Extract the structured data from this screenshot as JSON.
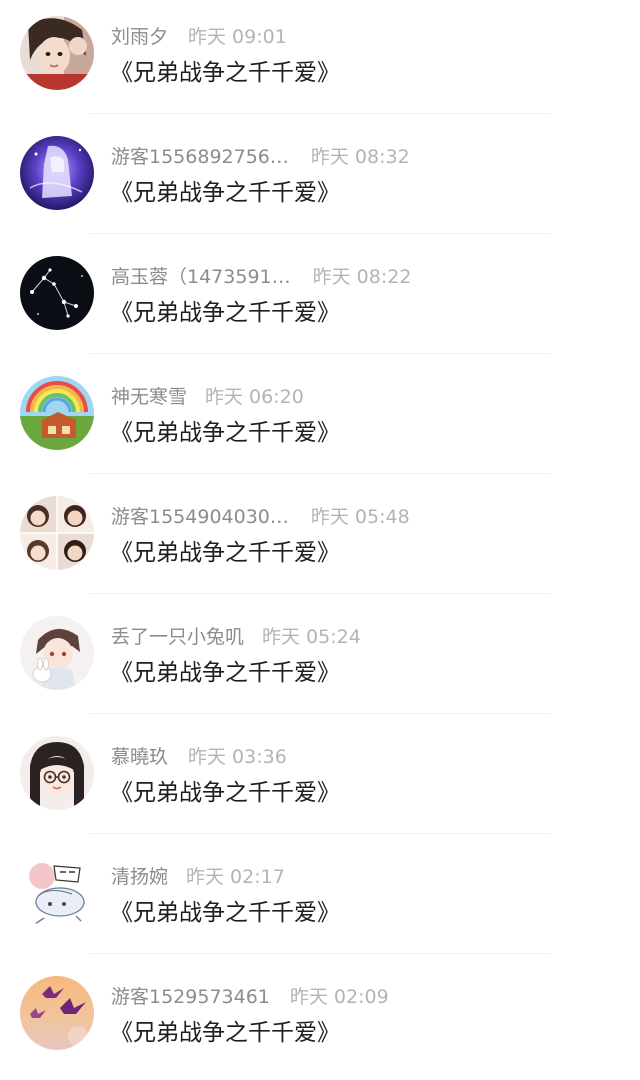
{
  "comments": [
    {
      "name": "刘雨夕",
      "time": "昨天 09:01",
      "message": "《兄弟战争之千千爱》",
      "avatar": "avatar-girl-selfie"
    },
    {
      "name": "游客1556892756…",
      "time": "昨天 08:32",
      "message": "《兄弟战争之千千爱》",
      "avatar": "avatar-anime-purple"
    },
    {
      "name": "高玉蓉（1473591…",
      "time": "昨天 08:22",
      "message": "《兄弟战争之千千爱》",
      "avatar": "avatar-constellation"
    },
    {
      "name": "神无寒雪",
      "time": "昨天 06:20",
      "message": "《兄弟战争之千千爱》",
      "avatar": "avatar-rainbow-house"
    },
    {
      "name": "游客1554904030…",
      "time": "昨天 05:48",
      "message": "《兄弟战争之千千爱》",
      "avatar": "avatar-four-girls"
    },
    {
      "name": "丢了一只小兔叽",
      "time": "昨天 05:24",
      "message": "《兄弟战争之千千爱》",
      "avatar": "avatar-anime-boy"
    },
    {
      "name": "慕曉玖",
      "time": "昨天 03:36",
      "message": "《兄弟战争之千千爱》",
      "avatar": "avatar-girl-glasses"
    },
    {
      "name": "清扬婉",
      "time": "昨天 02:17",
      "message": "《兄弟战争之千千爱》",
      "avatar": "avatar-cartoon-sticker"
    },
    {
      "name": "游客1529573461",
      "time": "昨天 02:09",
      "message": "《兄弟战争之千千爱》",
      "avatar": "avatar-paper-cranes"
    }
  ]
}
